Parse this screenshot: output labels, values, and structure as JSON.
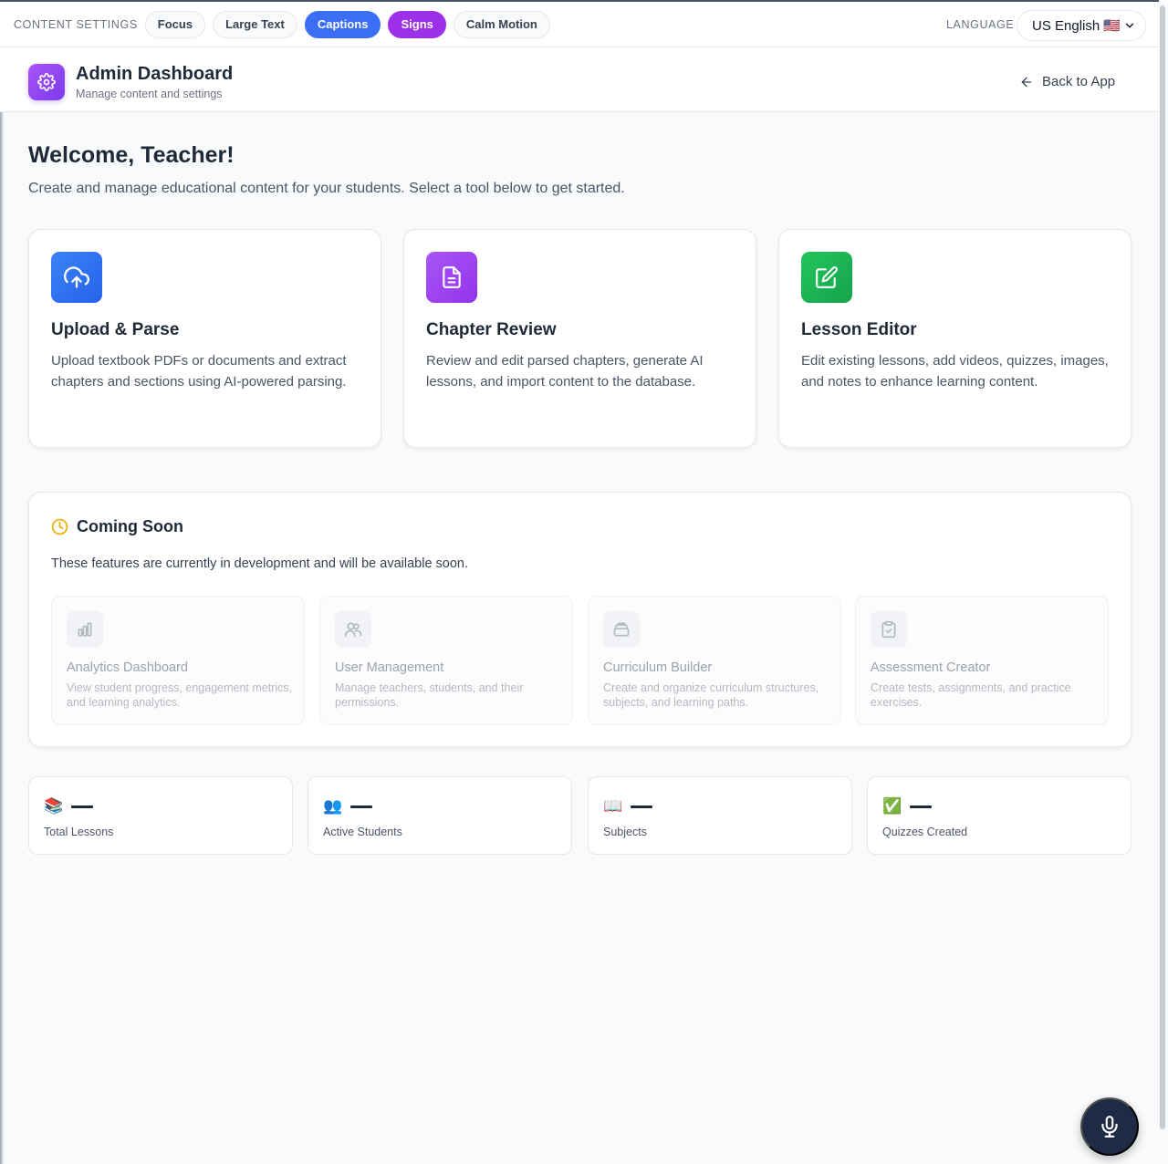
{
  "settings_bar": {
    "label": "CONTENT SETTINGS",
    "chips": [
      {
        "label": "Focus",
        "active": false
      },
      {
        "label": "Large Text",
        "active": false
      },
      {
        "label": "Captions",
        "active": true,
        "color": "#3b6ef5"
      },
      {
        "label": "Signs",
        "active": true,
        "color": "#9b30e8"
      },
      {
        "label": "Calm Motion",
        "active": false
      }
    ],
    "language_label": "LANGUAGE",
    "language_value": "US English 🇺🇸"
  },
  "header": {
    "title": "Admin Dashboard",
    "subtitle": "Manage content and settings",
    "back_label": "Back to App"
  },
  "welcome": {
    "title": "Welcome, Teacher!",
    "subtitle": "Create and manage educational content for your students. Select a tool below to get started."
  },
  "tools": [
    {
      "icon": "upload-cloud-icon",
      "color": "#3b82f6",
      "title": "Upload & Parse",
      "desc": "Upload textbook PDFs or documents and extract chapters and sections using AI-powered parsing."
    },
    {
      "icon": "document-icon",
      "color": "#a855f7",
      "title": "Chapter Review",
      "desc": "Review and edit parsed chapters, generate AI lessons, and import content to the database."
    },
    {
      "icon": "edit-icon",
      "color": "#22c55e",
      "title": "Lesson Editor",
      "desc": "Edit existing lessons, add videos, quizzes, images, and notes to enhance learning content."
    }
  ],
  "coming_soon": {
    "title": "Coming Soon",
    "desc": "These features are currently in development and will be available soon.",
    "items": [
      {
        "icon": "bar-chart-icon",
        "title": "Analytics Dashboard",
        "desc": "View student progress, engagement metrics, and learning analytics."
      },
      {
        "icon": "users-icon",
        "title": "User Management",
        "desc": "Manage teachers, students, and their permissions."
      },
      {
        "icon": "layers-icon",
        "title": "Curriculum Builder",
        "desc": "Create and organize curriculum structures, subjects, and learning paths."
      },
      {
        "icon": "clipboard-check-icon",
        "title": "Assessment Creator",
        "desc": "Create tests, assignments, and practice exercises."
      }
    ]
  },
  "stats": [
    {
      "emoji": "📚",
      "label": "Total Lessons"
    },
    {
      "emoji": "👥",
      "label": "Active Students"
    },
    {
      "emoji": "📖",
      "label": "Subjects"
    },
    {
      "emoji": "✅",
      "label": "Quizzes Created"
    }
  ]
}
